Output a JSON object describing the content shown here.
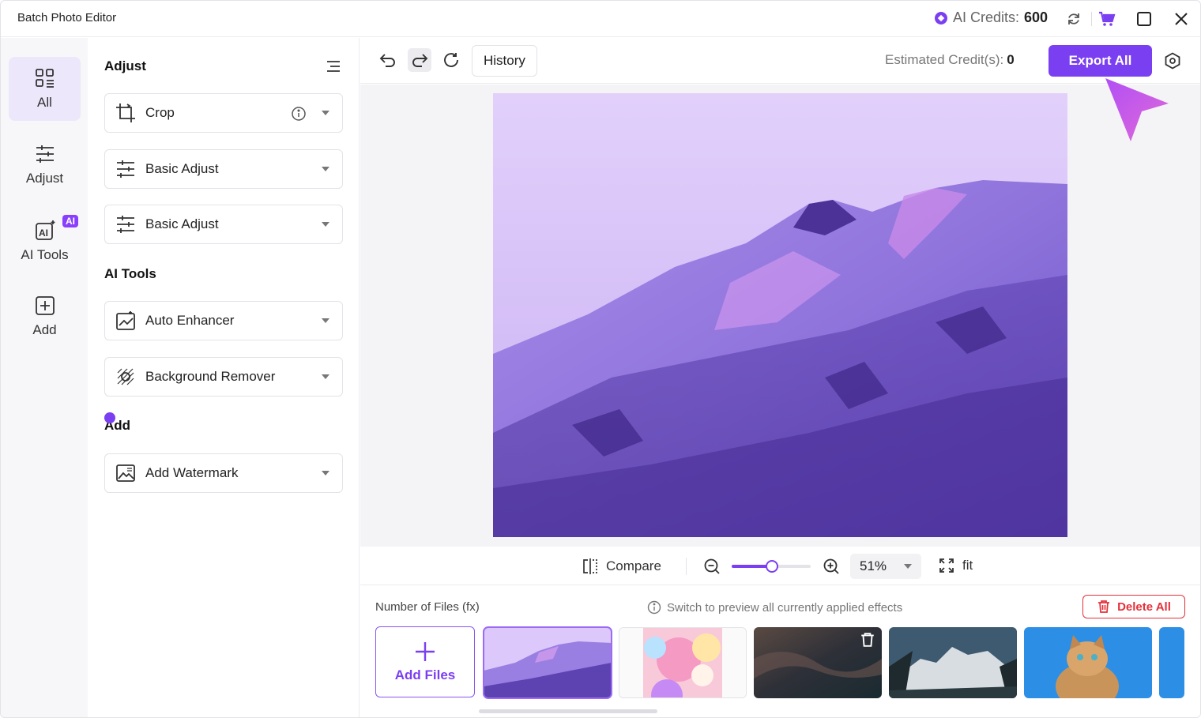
{
  "app": {
    "title": "Batch Photo Editor"
  },
  "credits": {
    "label": "AI Credits:",
    "value": "600"
  },
  "rail": [
    {
      "label": "All",
      "icon": "grid-icon",
      "active": true
    },
    {
      "label": "Adjust",
      "icon": "sliders-icon"
    },
    {
      "label": "AI Tools",
      "icon": "ai-icon",
      "badge": "AI"
    },
    {
      "label": "Add",
      "icon": "plus-square-icon"
    }
  ],
  "panel": {
    "adjust_title": "Adjust",
    "ai_title": "AI Tools",
    "add_title": "Add",
    "adjust_tools": [
      {
        "label": "Crop",
        "icon": "crop-icon",
        "info": true
      },
      {
        "label": "Basic Adjust",
        "icon": "sliders-icon"
      },
      {
        "label": "Basic Adjust",
        "icon": "sliders-icon"
      }
    ],
    "ai_tools": [
      {
        "label": "Auto Enhancer",
        "icon": "enhance-icon"
      },
      {
        "label": "Background Remover",
        "icon": "bg-remove-icon"
      }
    ],
    "add_tools": [
      {
        "label": "Add Watermark",
        "icon": "watermark-icon"
      }
    ]
  },
  "toolbar": {
    "history_label": "History",
    "estimated_label": "Estimated Credit(s):",
    "estimated_value": "0",
    "export_label": "Export All"
  },
  "zoombar": {
    "compare_label": "Compare",
    "zoom_value": "51%",
    "zoom_fraction": 0.51,
    "fit_label": "fit"
  },
  "files": {
    "count_label": "Number of Files (fx)",
    "hint": "Switch to preview all currently applied effects",
    "delete_label": "Delete All",
    "add_label": "Add Files"
  },
  "colors": {
    "accent": "#7b3ff2",
    "danger": "#e5303a"
  }
}
